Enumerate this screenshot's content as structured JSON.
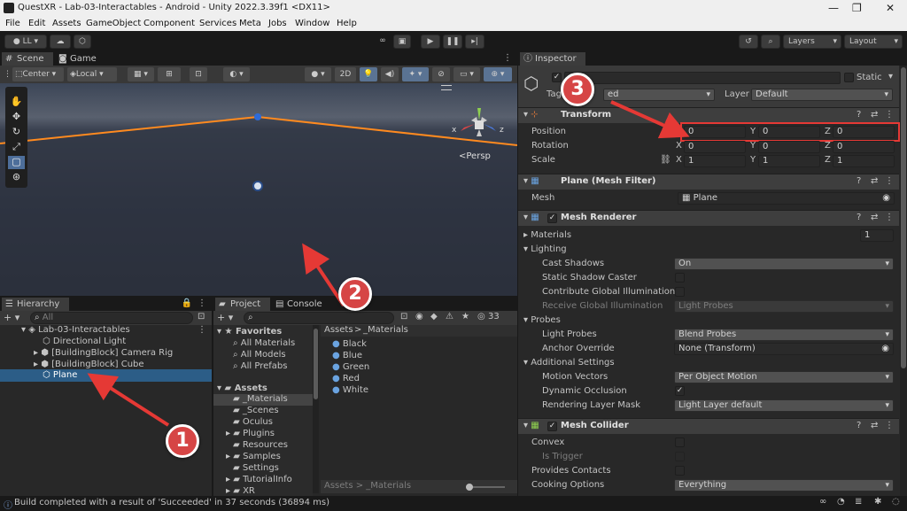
{
  "window": {
    "title": "QuestXR - Lab-03-Interactables - Android - Unity 2022.3.39f1 <DX11>",
    "min": "—",
    "max": "❐",
    "close": "✕"
  },
  "menu": [
    "File",
    "Edit",
    "Assets",
    "GameObject",
    "Component",
    "Services",
    "Meta",
    "Jobs",
    "Window",
    "Help"
  ],
  "toolbar": {
    "account": "LL",
    "layers": "Layers",
    "layout": "Layout"
  },
  "scene": {
    "tab_scene": "Scene",
    "tab_game": "Game",
    "pivot": "Center",
    "space": "Local",
    "mode2d": "2D",
    "persp": "<Persp",
    "axis_x": "x",
    "axis_z": "z"
  },
  "hierarchy": {
    "tab": "Hierarchy",
    "search_placeholder": "All",
    "scene_name": "Lab-03-Interactables",
    "items": [
      "Directional Light",
      "[BuildingBlock] Camera Rig",
      "[BuildingBlock] Cube",
      "Plane"
    ]
  },
  "project": {
    "tab_project": "Project",
    "tab_console": "Console",
    "count": "33",
    "favorites": "Favorites",
    "fav_items": [
      "All Materials",
      "All Models",
      "All Prefabs"
    ],
    "assets": "Assets",
    "folders": [
      "_Materials",
      "_Scenes",
      "Oculus",
      "Plugins",
      "Resources",
      "Samples",
      "Settings",
      "TutorialInfo",
      "XR"
    ],
    "breadcrumb_root": "Assets",
    "breadcrumb_sep": ">",
    "breadcrumb_current": "_Materials",
    "materials": [
      "Black",
      "Blue",
      "Green",
      "Red",
      "White"
    ],
    "footer_path": "Assets > _Materials"
  },
  "inspector": {
    "tab": "Inspector",
    "static_label": "Static",
    "tag_label": "Tag",
    "tag_value": "ed",
    "layer_label": "Layer",
    "layer_value": "Default",
    "transform": {
      "title": "Transform",
      "position_label": "Position",
      "rotation_label": "Rotation",
      "scale_label": "Scale",
      "axis_x": "X",
      "axis_y": "Y",
      "axis_z": "Z",
      "position": [
        "0",
        "0",
        "0"
      ],
      "rotation": [
        "0",
        "0",
        "0"
      ],
      "scale": [
        "1",
        "1",
        "1"
      ]
    },
    "mesh_filter": {
      "title": "Plane (Mesh Filter)",
      "mesh_label": "Mesh",
      "mesh_value": "Plane"
    },
    "mesh_renderer": {
      "title": "Mesh Renderer",
      "materials_label": "Materials",
      "materials_count": "1",
      "lighting": "Lighting",
      "cast_shadows_label": "Cast Shadows",
      "cast_shadows_value": "On",
      "static_shadow_label": "Static Shadow Caster",
      "contribute_gi_label": "Contribute Global Illumination",
      "receive_gi_label": "Receive Global Illumination",
      "receive_gi_value": "Light Probes",
      "probes": "Probes",
      "light_probes_label": "Light Probes",
      "light_probes_value": "Blend Probes",
      "anchor_label": "Anchor Override",
      "anchor_value": "None (Transform)",
      "additional": "Additional Settings",
      "motion_label": "Motion Vectors",
      "motion_value": "Per Object Motion",
      "dynamic_occ_label": "Dynamic Occlusion",
      "rendering_mask_label": "Rendering Layer Mask",
      "rendering_mask_value": "Light Layer default"
    },
    "mesh_collider": {
      "title": "Mesh Collider",
      "convex_label": "Convex",
      "trigger_label": "Is Trigger",
      "contacts_label": "Provides Contacts",
      "cooking_label": "Cooking Options",
      "cooking_value": "Everything"
    }
  },
  "annotations": [
    "1",
    "2",
    "3"
  ],
  "status": "Build completed with a result of 'Succeeded' in 37 seconds (36894 ms)",
  "colors": {
    "accent_orange": "#ff8a1f",
    "selection_blue": "#2c5d87",
    "annotation_red": "#d64545",
    "highlight_box": "#e53935"
  }
}
